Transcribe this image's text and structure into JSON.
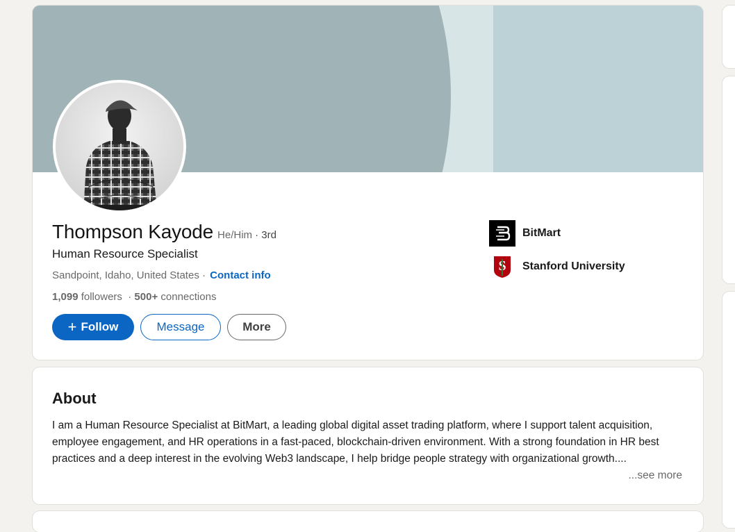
{
  "profile": {
    "name": "Thompson Kayode",
    "pronouns": "He/Him",
    "degree": "· 3rd",
    "headline": "Human Resource Specialist",
    "location": "Sandpoint, Idaho, United States",
    "location_separator": "·",
    "contact_info": "Contact info",
    "followers_count": "1,099",
    "followers_label": "followers",
    "connections_separator": "·",
    "connections_count": "500+",
    "connections_label": "connections"
  },
  "actions": {
    "follow_label": "Follow",
    "message_label": "Message",
    "more_label": "More"
  },
  "organizations": [
    {
      "name": "BitMart",
      "icon": "bitmart-logo-icon"
    },
    {
      "name": "Stanford University",
      "icon": "stanford-logo-icon"
    }
  ],
  "about": {
    "title": "About",
    "text": "I am a Human Resource Specialist at BitMart, a leading global digital asset trading platform, where I support talent acquisition, employee engagement, and HR operations in a fast-paced, blockchain-driven environment. With a strong foundation in HR best practices and a deep interest in the evolving Web3 landscape, I help bridge people strategy with organizational growth....",
    "see_more": "...see more"
  },
  "colors": {
    "primary": "#0a66c2",
    "background": "#f3f2ee",
    "banner_dark": "#a0b3b6",
    "banner_light": "#bdd2d6",
    "stanford_red": "#b1040e"
  }
}
